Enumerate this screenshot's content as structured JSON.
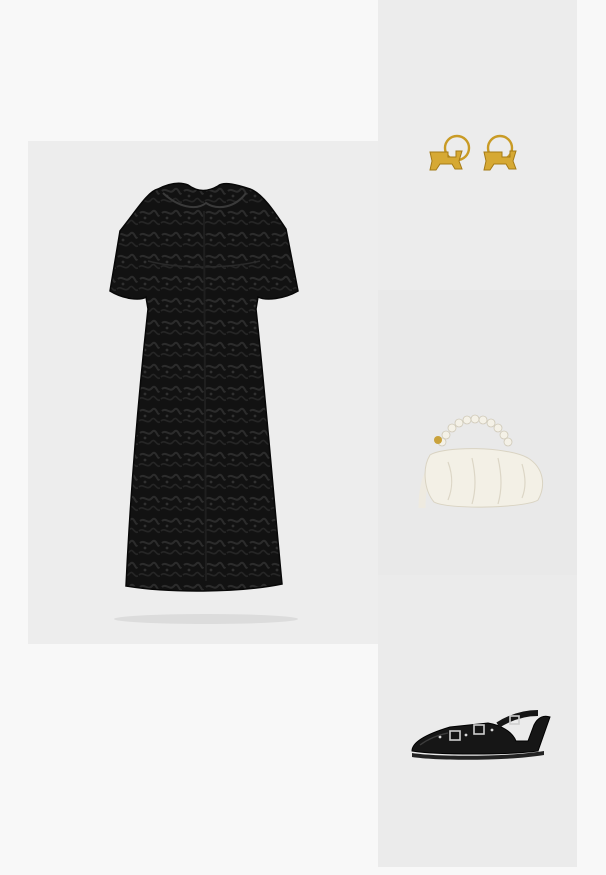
{
  "outfit": {
    "items": [
      {
        "id": "dress",
        "label": "",
        "icon": "dress-icon",
        "color": "#0f0f0f"
      },
      {
        "id": "earrings",
        "label": "",
        "icon": "earrings-icon",
        "color": "#d4a72c"
      },
      {
        "id": "bag",
        "label": "",
        "icon": "handbag-icon",
        "color": "#f3f0e6"
      },
      {
        "id": "shoes",
        "label": "",
        "icon": "slingback-flats-icon",
        "color": "#151515"
      }
    ]
  },
  "colors": {
    "page_background": "#f8f8f8",
    "tile_background": "#ececec"
  }
}
